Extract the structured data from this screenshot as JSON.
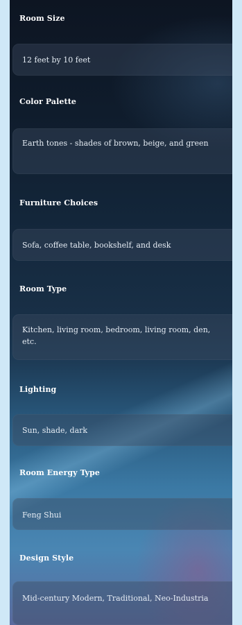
{
  "fields": [
    {
      "label": "Room Size",
      "value": "12 feet by 10 feet"
    },
    {
      "label": "Color Palette",
      "value": "Earth tones - shades of brown, beige, and green"
    },
    {
      "label": "Furniture Choices",
      "value": "Sofa, coffee table, bookshelf, and desk"
    },
    {
      "label": "Room Type",
      "value": "Kitchen, living room, bedroom, living room, den, etc."
    },
    {
      "label": "Lighting",
      "value": "Sun, shade, dark"
    },
    {
      "label": "Room Energy Type",
      "value": "Feng Shui"
    },
    {
      "label": "Design Style",
      "value": "Mid-century Modern, Traditional, Neo-Industria"
    }
  ]
}
